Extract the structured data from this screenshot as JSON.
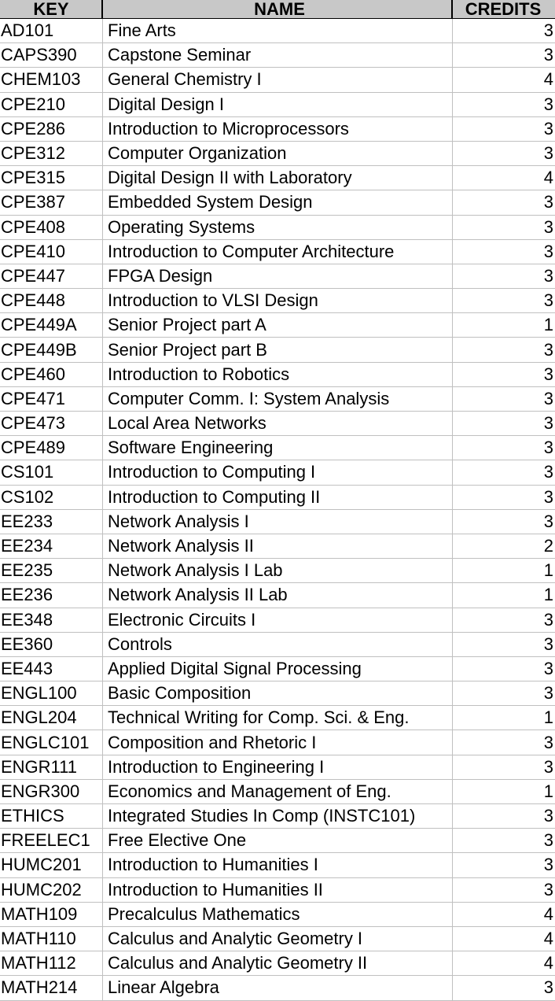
{
  "table": {
    "headers": {
      "key": "KEY",
      "name": "NAME",
      "credits": "CREDITS"
    },
    "rows": [
      {
        "key": "AD101",
        "name": "Fine Arts",
        "credits": "3"
      },
      {
        "key": "CAPS390",
        "name": "Capstone Seminar",
        "credits": "3"
      },
      {
        "key": "CHEM103",
        "name": "General Chemistry I",
        "credits": "4"
      },
      {
        "key": "CPE210",
        "name": "Digital Design I",
        "credits": "3"
      },
      {
        "key": "CPE286",
        "name": "Introduction to Microprocessors",
        "credits": "3"
      },
      {
        "key": "CPE312",
        "name": "Computer Organization",
        "credits": "3"
      },
      {
        "key": "CPE315",
        "name": "Digital Design II with Laboratory",
        "credits": "4"
      },
      {
        "key": "CPE387",
        "name": "Embedded System Design",
        "credits": "3"
      },
      {
        "key": "CPE408",
        "name": "Operating Systems",
        "credits": "3"
      },
      {
        "key": "CPE410",
        "name": "Introduction to Computer Architecture",
        "credits": "3"
      },
      {
        "key": "CPE447",
        "name": "FPGA Design",
        "credits": "3"
      },
      {
        "key": "CPE448",
        "name": "Introduction to VLSI Design",
        "credits": "3"
      },
      {
        "key": "CPE449A",
        "name": "Senior Project part A",
        "credits": "1"
      },
      {
        "key": "CPE449B",
        "name": "Senior Project part B",
        "credits": "3"
      },
      {
        "key": "CPE460",
        "name": "Introduction to Robotics",
        "credits": "3"
      },
      {
        "key": "CPE471",
        "name": "Computer Comm. I: System Analysis",
        "credits": "3"
      },
      {
        "key": "CPE473",
        "name": "Local Area Networks",
        "credits": "3"
      },
      {
        "key": "CPE489",
        "name": "Software Engineering",
        "credits": "3"
      },
      {
        "key": "CS101",
        "name": "Introduction to Computing I",
        "credits": "3"
      },
      {
        "key": "CS102",
        "name": "Introduction to Computing II",
        "credits": "3"
      },
      {
        "key": "EE233",
        "name": "Network Analysis I",
        "credits": "3"
      },
      {
        "key": "EE234",
        "name": "Network Analysis II",
        "credits": "2"
      },
      {
        "key": "EE235",
        "name": "Network Analysis I Lab",
        "credits": "1"
      },
      {
        "key": "EE236",
        "name": "Network Analysis II Lab",
        "credits": "1"
      },
      {
        "key": "EE348",
        "name": "Electronic Circuits I",
        "credits": "3"
      },
      {
        "key": "EE360",
        "name": "Controls",
        "credits": "3"
      },
      {
        "key": "EE443",
        "name": "Applied Digital Signal Processing",
        "credits": "3"
      },
      {
        "key": "ENGL100",
        "name": "Basic Composition",
        "credits": "3"
      },
      {
        "key": "ENGL204",
        "name": "Technical Writing for Comp. Sci. & Eng.",
        "credits": "1"
      },
      {
        "key": "ENGLC101",
        "name": "Composition and Rhetoric I",
        "credits": "3"
      },
      {
        "key": "ENGR111",
        "name": "Introduction to Engineering I",
        "credits": "3"
      },
      {
        "key": "ENGR300",
        "name": "Economics and Management of Eng.",
        "credits": "1"
      },
      {
        "key": "ETHICS",
        "name": "Integrated Studies In Comp (INSTC101)",
        "credits": "3"
      },
      {
        "key": "FREELEC1",
        "name": "Free Elective One",
        "credits": "3"
      },
      {
        "key": "HUMC201",
        "name": "Introduction to Humanities I",
        "credits": "3"
      },
      {
        "key": "HUMC202",
        "name": "Introduction to Humanities II",
        "credits": "3"
      },
      {
        "key": "MATH109",
        "name": "Precalculus Mathematics",
        "credits": "4"
      },
      {
        "key": "MATH110",
        "name": "Calculus and Analytic Geometry I",
        "credits": "4"
      },
      {
        "key": "MATH112",
        "name": "Calculus and Analytic Geometry II",
        "credits": "4"
      },
      {
        "key": "MATH214",
        "name": "Linear Algebra",
        "credits": "3"
      }
    ]
  }
}
